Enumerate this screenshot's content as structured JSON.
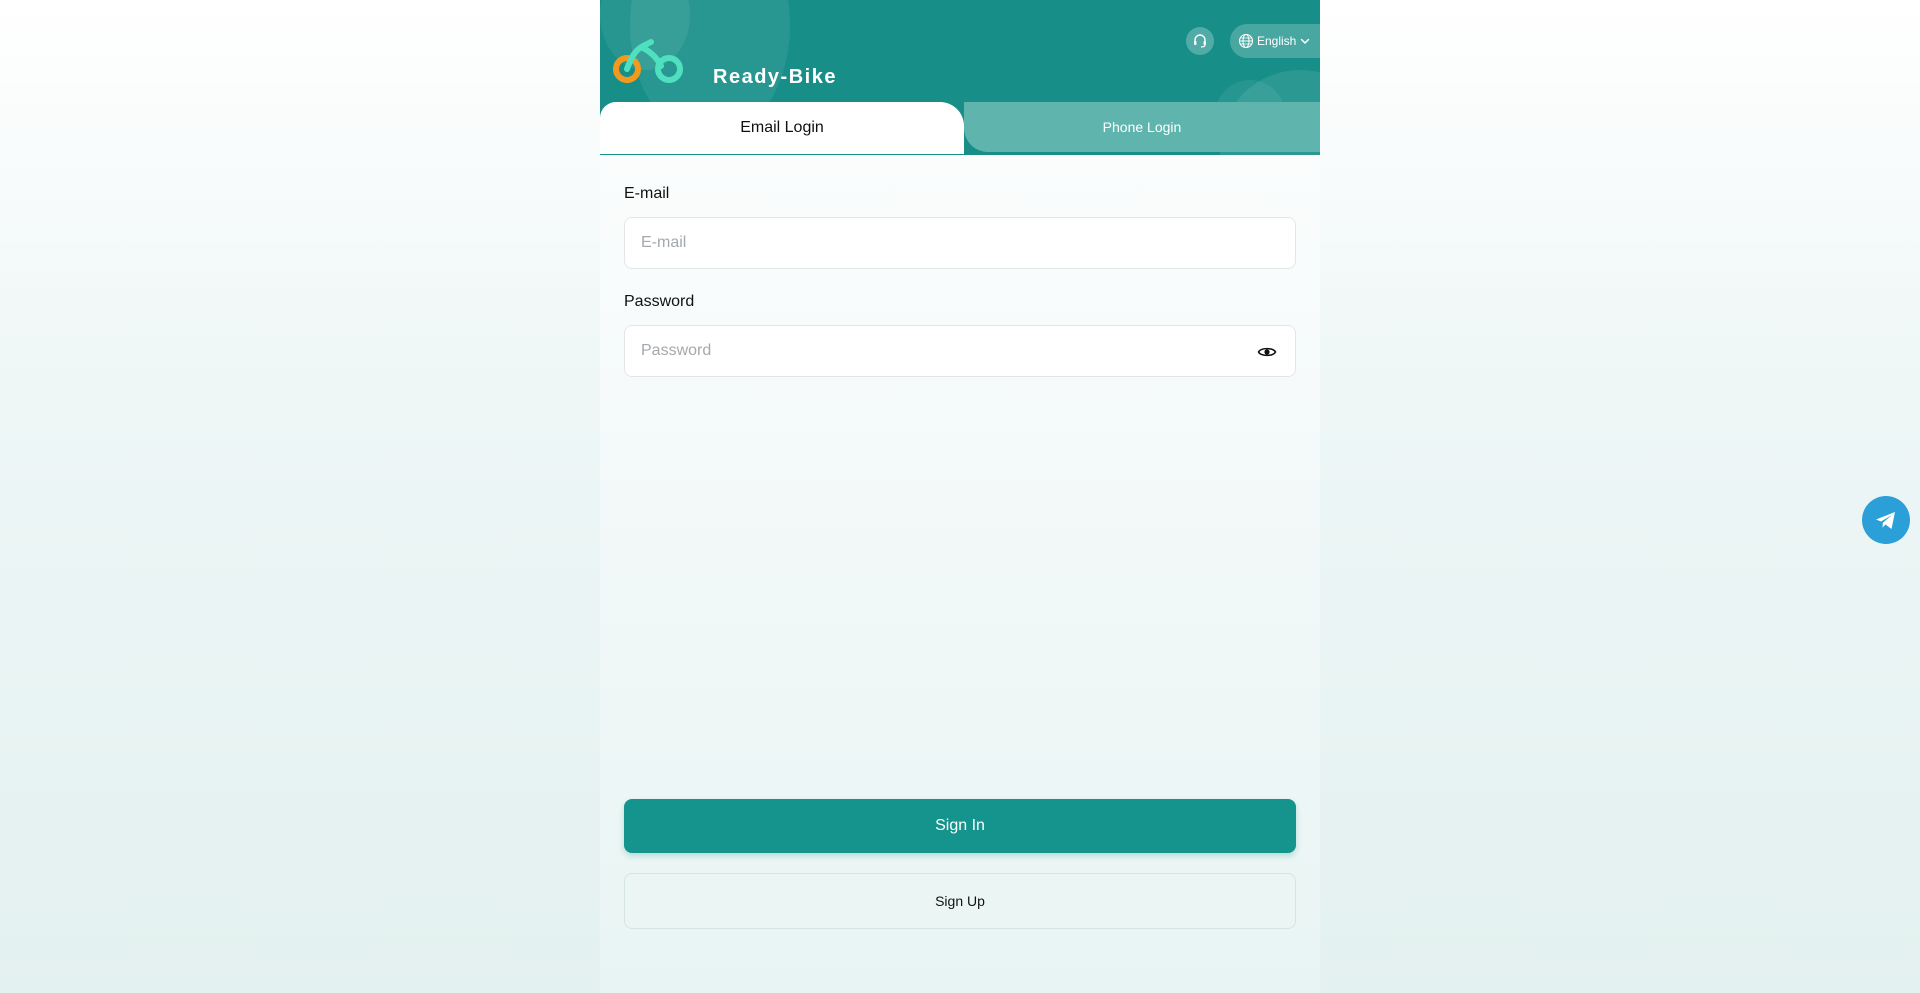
{
  "header": {
    "brand": "Ready-Bike",
    "logo_icon": "bike-logo-icon",
    "support_icon": "headset-icon",
    "language": {
      "icon": "globe-icon",
      "selected": "English",
      "chevron": "chevron-down-icon"
    }
  },
  "tabs": [
    {
      "label": "Email Login",
      "active": true
    },
    {
      "label": "Phone Login",
      "active": false
    }
  ],
  "form": {
    "email_label": "E-mail",
    "email_placeholder": "E-mail",
    "email_value": "",
    "password_label": "Password",
    "password_placeholder": "Password",
    "password_value": "",
    "password_toggle_icon": "eye-icon"
  },
  "actions": {
    "signin_label": "Sign In",
    "signup_label": "Sign Up"
  },
  "floating": {
    "telegram_icon": "telegram-icon"
  },
  "colors": {
    "primary": "#14948c",
    "header_bg": "#178f88",
    "inactive_tab": "#5fb4ae",
    "logo_orange": "#f39a1e",
    "logo_mint": "#4fe0c0",
    "telegram": "#2a9fd8"
  }
}
